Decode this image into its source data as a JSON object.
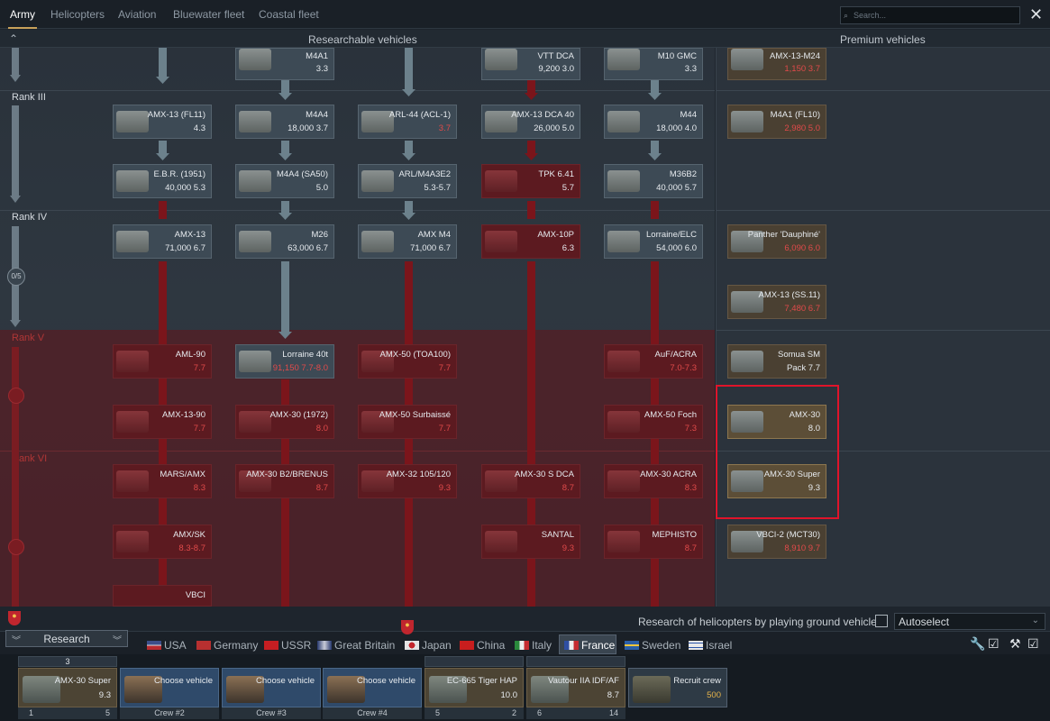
{
  "nav": {
    "tabs": [
      "Army",
      "Helicopters",
      "Aviation",
      "Bluewater fleet",
      "Coastal fleet"
    ],
    "search_placeholder": "Search..."
  },
  "headers": {
    "researchable": "Researchable vehicles",
    "premium": "Premium vehicles"
  },
  "ranks": {
    "r3": "Rank III",
    "r4": "Rank IV",
    "r5": "Rank V",
    "r6": "Rank VI",
    "counter": "0/5"
  },
  "tree": {
    "c1r1": {
      "name": "M4A1",
      "meta": "3.3"
    },
    "c3r0": {
      "name": "VTT DCA",
      "meta": "9,200 3.0"
    },
    "c4r0": {
      "name": "M10 GMC",
      "meta": "3.3"
    },
    "c0r2": {
      "name": "AMX-13 (FL11)",
      "meta": "4.3"
    },
    "c1r2": {
      "name": "M4A4",
      "meta": "18,000 3.7"
    },
    "c2r2": {
      "name": "ARL-44 (ACL-1)",
      "meta": "3.7"
    },
    "c3r2": {
      "name": "AMX-13 DCA 40",
      "meta": "26,000 5.0"
    },
    "c4r2": {
      "name": "M44",
      "meta": "18,000 4.0"
    },
    "c0r3": {
      "name": "E.B.R. (1951)",
      "meta": "40,000 5.3"
    },
    "c1r3": {
      "name": "M4A4 (SA50)",
      "meta": "5.0"
    },
    "c2r3": {
      "name": "ARL/M4A3E2",
      "meta": "5.3-5.7"
    },
    "c3r3": {
      "name": "TPK 6.41",
      "meta": "5.7"
    },
    "c4r3": {
      "name": "M36B2",
      "meta": "40,000 5.7"
    },
    "c0r4": {
      "name": "AMX-13",
      "meta": "71,000 6.7"
    },
    "c1r4": {
      "name": "M26",
      "meta": "63,000 6.7"
    },
    "c2r4": {
      "name": "AMX M4",
      "meta": "71,000 6.7"
    },
    "c3r4": {
      "name": "AMX-10P",
      "meta": "6.3"
    },
    "c4r4": {
      "name": "Lorraine/ELC",
      "meta": "54,000 6.0"
    },
    "c0r5": {
      "name": "AML-90",
      "meta": "7.7"
    },
    "c1r5": {
      "name": "Lorraine 40t",
      "meta": "91,150 7.7-8.0"
    },
    "c2r5": {
      "name": "AMX-50 (TOA100)",
      "meta": "7.7"
    },
    "c4r5": {
      "name": "AuF/ACRA",
      "meta": "7.0-7.3"
    },
    "c0r6": {
      "name": "AMX-13-90",
      "meta": "7.7"
    },
    "c1r6": {
      "name": "AMX-30 (1972)",
      "meta": "8.0"
    },
    "c2r6": {
      "name": "AMX-50 Surbaissé",
      "meta": "7.7"
    },
    "c4r6": {
      "name": "AMX-50 Foch",
      "meta": "7.3"
    },
    "c0r7": {
      "name": "MARS/AMX",
      "meta": "8.3"
    },
    "c1r7": {
      "name": "AMX-30 B2/BRENUS",
      "meta": "8.7"
    },
    "c2r7": {
      "name": "AMX-32 105/120",
      "meta": "9.3"
    },
    "c3r7": {
      "name": "AMX-30 S DCA",
      "meta": "8.7"
    },
    "c4r7": {
      "name": "AMX-30 ACRA",
      "meta": "8.3"
    },
    "c0r8": {
      "name": "AMX/SK",
      "meta": "8.3-8.7"
    },
    "c3r8": {
      "name": "SANTAL",
      "meta": "9.3"
    },
    "c4r8": {
      "name": "MEPHISTO",
      "meta": "8.7"
    },
    "c0r9": {
      "name": "VBCI",
      "meta": ""
    }
  },
  "premium": {
    "p0": {
      "name": "AMX-13-M24",
      "meta": "1,150 3.7"
    },
    "p1": {
      "name": "M4A1 (FL10)",
      "meta": "2,980 5.0"
    },
    "p2": {
      "name": "Panther 'Dauphiné'",
      "meta": "6,090 6.0"
    },
    "p3": {
      "name": "AMX-13 (SS.11)",
      "meta": "7,480 6.7"
    },
    "p4": {
      "name": "Somua SM",
      "meta": "Pack 7.7"
    },
    "p5": {
      "name": "AMX-30",
      "meta": "8.0"
    },
    "p6": {
      "name": "AMX-30 Super",
      "meta": "9.3"
    },
    "p7": {
      "name": "VBCI-2 (MCT30)",
      "meta": "8,910 9.7"
    }
  },
  "research_bar": {
    "heli_text": "Research of helicopters by playing ground vehicles",
    "autoselect": "Autoselect",
    "research_btn": "Research"
  },
  "nations": [
    "USA",
    "Germany",
    "USSR",
    "Great Britain",
    "Japan",
    "China",
    "Italy",
    "France",
    "Sweden",
    "Israel"
  ],
  "crew": [
    {
      "name": "AMX-30 Super",
      "val": "9.3",
      "foot_l": "1",
      "foot_r": "5",
      "top": "3"
    },
    {
      "name": "Choose vehicle",
      "val": "",
      "foot_c": "Crew #2"
    },
    {
      "name": "Choose vehicle",
      "val": "",
      "foot_c": "Crew #3"
    },
    {
      "name": "Choose vehicle",
      "val": "",
      "foot_c": "Crew #4"
    },
    {
      "name": "EC-665 Tiger HAP",
      "val": "10.0",
      "foot_l": "5",
      "foot_r": "2"
    },
    {
      "name": "Vautour IIA IDF/AF",
      "val": "8.7",
      "foot_l": "6",
      "foot_r": "14"
    },
    {
      "name": "Recruit crew",
      "val": "500"
    }
  ]
}
